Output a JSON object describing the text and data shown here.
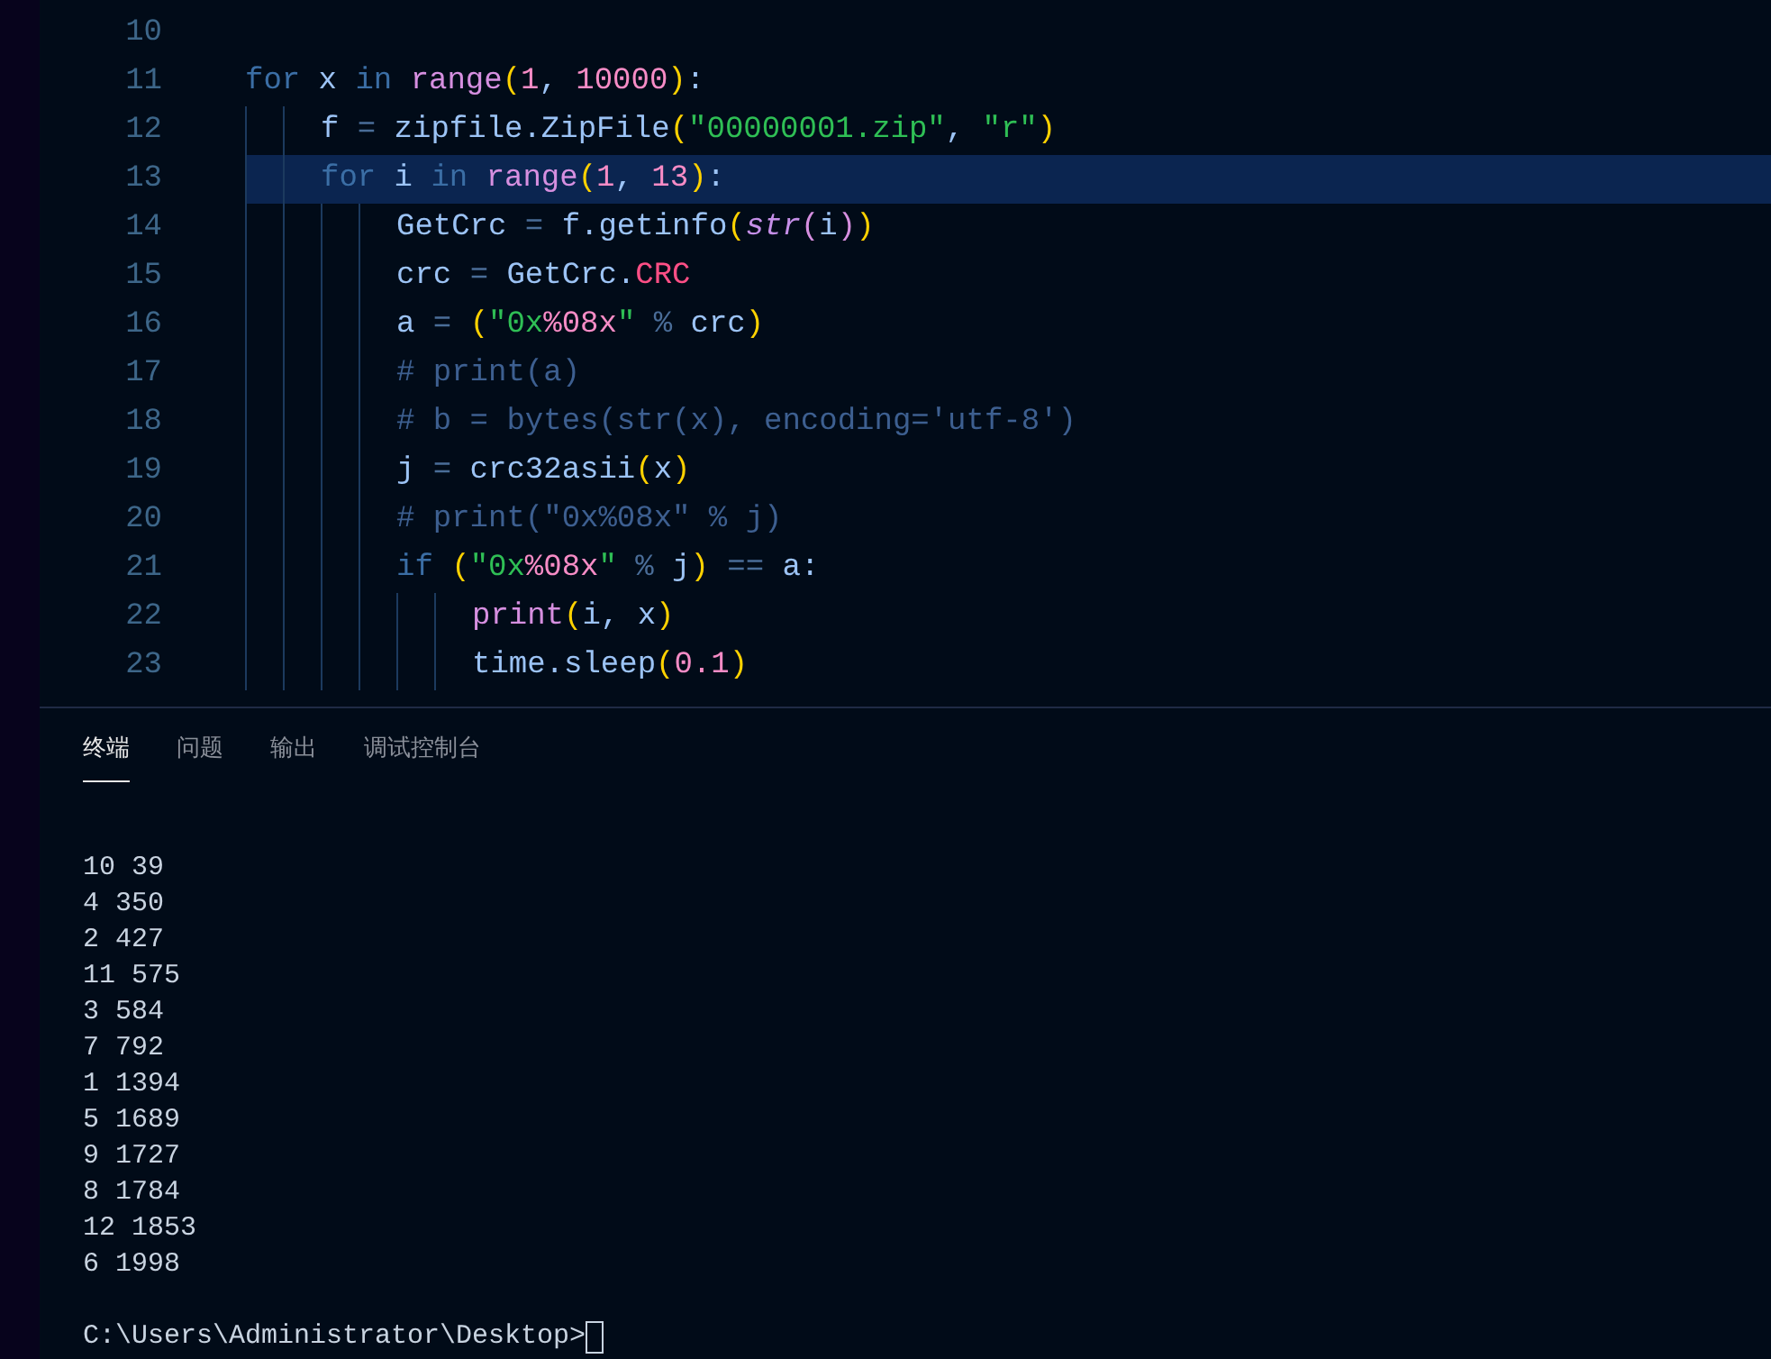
{
  "editor": {
    "lines": [
      {
        "number": "10",
        "highlighted": false
      },
      {
        "number": "11",
        "highlighted": false,
        "tokens": [
          {
            "kind": "kw",
            "text": "for"
          },
          {
            "kind": "id",
            "text": " x "
          },
          {
            "kind": "kw",
            "text": "in "
          },
          {
            "kind": "fn",
            "text": "range"
          },
          {
            "kind": "paren",
            "text": "("
          },
          {
            "kind": "num",
            "text": "1"
          },
          {
            "kind": "id",
            "text": ", "
          },
          {
            "kind": "num",
            "text": "10000"
          },
          {
            "kind": "paren",
            "text": ")"
          },
          {
            "kind": "id",
            "text": ":"
          }
        ],
        "children": [
          {
            "number": "12",
            "highlighted": false,
            "tokens": [
              {
                "kind": "id",
                "text": "f "
              },
              {
                "kind": "op",
                "text": "="
              },
              {
                "kind": "id",
                "text": " zipfile.ZipFile"
              },
              {
                "kind": "paren",
                "text": "("
              },
              {
                "kind": "str",
                "text": "\"00000001.zip\""
              },
              {
                "kind": "id",
                "text": ", "
              },
              {
                "kind": "str",
                "text": "\"r\""
              },
              {
                "kind": "paren",
                "text": ")"
              }
            ]
          },
          {
            "number": "13",
            "highlighted": true,
            "tokens": [
              {
                "kind": "kw",
                "text": "for"
              },
              {
                "kind": "id",
                "text": " i "
              },
              {
                "kind": "kw",
                "text": "in "
              },
              {
                "kind": "fn",
                "text": "range"
              },
              {
                "kind": "paren",
                "text": "("
              },
              {
                "kind": "num",
                "text": "1"
              },
              {
                "kind": "id",
                "text": ", "
              },
              {
                "kind": "num",
                "text": "13"
              },
              {
                "kind": "paren",
                "text": ")"
              },
              {
                "kind": "id",
                "text": ":"
              }
            ],
            "children": [
              {
                "number": "14",
                "highlighted": false,
                "tokens": [
                  {
                    "kind": "id",
                    "text": "GetCrc "
                  },
                  {
                    "kind": "op",
                    "text": "="
                  },
                  {
                    "kind": "id",
                    "text": " f.getinfo"
                  },
                  {
                    "kind": "paren",
                    "text": "("
                  },
                  {
                    "kind": "builtin",
                    "text": "str"
                  },
                  {
                    "kind": "fn",
                    "text": "("
                  },
                  {
                    "kind": "id",
                    "text": "i"
                  },
                  {
                    "kind": "fn",
                    "text": ")"
                  },
                  {
                    "kind": "paren",
                    "text": ")"
                  }
                ]
              },
              {
                "number": "15",
                "highlighted": false,
                "tokens": [
                  {
                    "kind": "id",
                    "text": "crc "
                  },
                  {
                    "kind": "op",
                    "text": "="
                  },
                  {
                    "kind": "id",
                    "text": " GetCrc."
                  },
                  {
                    "kind": "attr",
                    "text": "CRC"
                  }
                ]
              },
              {
                "number": "16",
                "highlighted": false,
                "tokens": [
                  {
                    "kind": "id",
                    "text": "a "
                  },
                  {
                    "kind": "op",
                    "text": "= "
                  },
                  {
                    "kind": "paren",
                    "text": "("
                  },
                  {
                    "kind": "str",
                    "text": "\"0x"
                  },
                  {
                    "kind": "fmt",
                    "text": "%08x"
                  },
                  {
                    "kind": "str",
                    "text": "\""
                  },
                  {
                    "kind": "op",
                    "text": " % "
                  },
                  {
                    "kind": "id",
                    "text": "crc"
                  },
                  {
                    "kind": "paren",
                    "text": ")"
                  }
                ]
              },
              {
                "number": "17",
                "highlighted": false,
                "tokens": [
                  {
                    "kind": "comment",
                    "text": "# print(a)"
                  }
                ]
              },
              {
                "number": "18",
                "highlighted": false,
                "tokens": [
                  {
                    "kind": "comment",
                    "text": "# b = bytes(str(x), encoding='utf-8')"
                  }
                ]
              },
              {
                "number": "19",
                "highlighted": false,
                "tokens": [
                  {
                    "kind": "id",
                    "text": "j "
                  },
                  {
                    "kind": "op",
                    "text": "="
                  },
                  {
                    "kind": "id",
                    "text": " crc32asii"
                  },
                  {
                    "kind": "paren",
                    "text": "("
                  },
                  {
                    "kind": "id",
                    "text": "x"
                  },
                  {
                    "kind": "paren",
                    "text": ")"
                  }
                ]
              },
              {
                "number": "20",
                "highlighted": false,
                "tokens": [
                  {
                    "kind": "comment",
                    "text": "# print(\"0x%08x\" % j)"
                  }
                ]
              },
              {
                "number": "21",
                "highlighted": false,
                "tokens": [
                  {
                    "kind": "kw",
                    "text": "if "
                  },
                  {
                    "kind": "paren",
                    "text": "("
                  },
                  {
                    "kind": "str",
                    "text": "\"0x"
                  },
                  {
                    "kind": "fmt",
                    "text": "%08x"
                  },
                  {
                    "kind": "str",
                    "text": "\""
                  },
                  {
                    "kind": "op",
                    "text": " % "
                  },
                  {
                    "kind": "id",
                    "text": "j"
                  },
                  {
                    "kind": "paren",
                    "text": ")"
                  },
                  {
                    "kind": "op",
                    "text": " == "
                  },
                  {
                    "kind": "id",
                    "text": "a:"
                  }
                ],
                "children": [
                  {
                    "number": "22",
                    "highlighted": false,
                    "tokens": [
                      {
                        "kind": "fn",
                        "text": "print"
                      },
                      {
                        "kind": "paren",
                        "text": "("
                      },
                      {
                        "kind": "id",
                        "text": "i, x"
                      },
                      {
                        "kind": "paren",
                        "text": ")"
                      }
                    ]
                  },
                  {
                    "number": "23",
                    "highlighted": false,
                    "tokens": [
                      {
                        "kind": "id",
                        "text": "time.sleep"
                      },
                      {
                        "kind": "paren",
                        "text": "("
                      },
                      {
                        "kind": "num",
                        "text": "0.1"
                      },
                      {
                        "kind": "paren",
                        "text": ")"
                      }
                    ]
                  }
                ]
              }
            ]
          }
        ]
      }
    ]
  },
  "panel": {
    "tabs": [
      {
        "label": "终端",
        "selected": true
      },
      {
        "label": "问题",
        "selected": false
      },
      {
        "label": "输出",
        "selected": false
      },
      {
        "label": "调试控制台",
        "selected": false
      }
    ],
    "output": [
      "10 39",
      "4 350",
      "2 427",
      "11 575",
      "3 584",
      "7 792",
      "1 1394",
      "5 1689",
      "9 1727",
      "8 1784",
      "12 1853",
      "6 1998"
    ],
    "prompt": "C:\\Users\\Administrator\\Desktop>"
  }
}
